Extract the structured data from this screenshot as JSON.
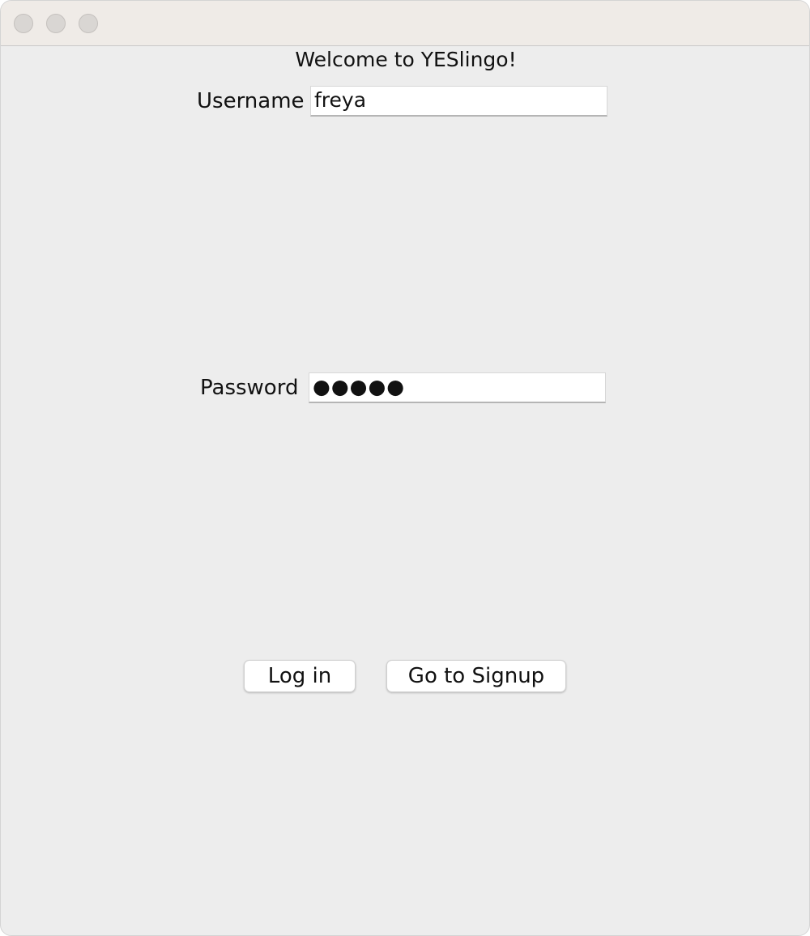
{
  "window": {
    "controls": [
      "close-icon",
      "minimize-icon",
      "zoom-icon"
    ]
  },
  "welcome": "Welcome to YESlingo!",
  "form": {
    "username_label": "Username",
    "username_value": "freya",
    "password_label": "Password",
    "password_value": "●●●●●"
  },
  "buttons": {
    "login": "Log in",
    "signup": "Go to Signup"
  }
}
